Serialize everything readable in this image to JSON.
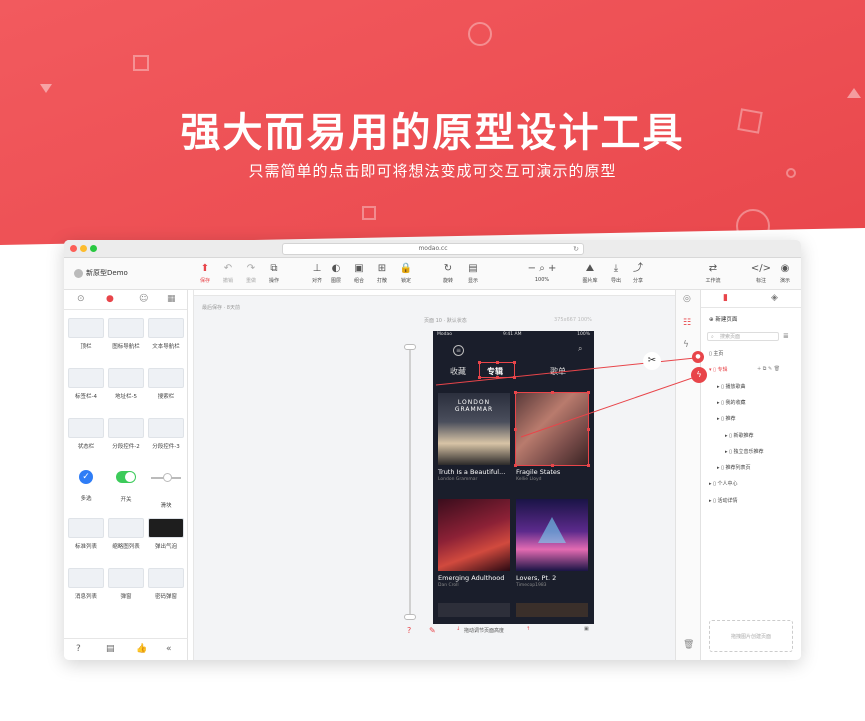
{
  "hero": {
    "title": "强大而易用的原型设计工具",
    "subtitle": "只需简单的点击即可将想法变成可交互可演示的原型"
  },
  "colors": {
    "brand": "#e8454a",
    "canvas": "#f3f4f6",
    "phone_bg": "#1a1e2b"
  },
  "browser": {
    "url": "modao.cc"
  },
  "project": {
    "name": "新原型Demo"
  },
  "toolbar": {
    "left": [
      {
        "icon": "save-icon",
        "label": "保存",
        "state": "active"
      },
      {
        "icon": "undo-icon",
        "label": "撤销",
        "state": "disabled"
      },
      {
        "icon": "redo-icon",
        "label": "重做",
        "state": "disabled"
      },
      {
        "icon": "action-icon",
        "label": "操作",
        "state": "normal"
      }
    ],
    "middle": [
      {
        "icon": "align-icon",
        "label": "对齐"
      },
      {
        "icon": "layer-order-icon",
        "label": "图层"
      },
      {
        "icon": "group-icon",
        "label": "组合"
      },
      {
        "icon": "ungroup-icon",
        "label": "打散"
      },
      {
        "icon": "lock-icon",
        "label": "锁定"
      }
    ],
    "view": [
      {
        "icon": "rotate-icon",
        "label": "旋转"
      },
      {
        "icon": "display-icon",
        "label": "显示"
      }
    ],
    "zoom": "100%",
    "right": [
      {
        "icon": "image-library-icon",
        "label": "图片库"
      },
      {
        "icon": "export-icon",
        "label": "导出"
      },
      {
        "icon": "share-icon",
        "label": "分享"
      }
    ],
    "far_right": [
      {
        "icon": "workflow-icon",
        "label": "工作流"
      },
      {
        "icon": "annotate-icon",
        "label": "标注"
      },
      {
        "icon": "preview-icon",
        "label": "演示"
      }
    ]
  },
  "components": [
    {
      "label": "顶栏"
    },
    {
      "label": "图标导航栏"
    },
    {
      "label": "文本导航栏"
    },
    {
      "label": "标签栏-4"
    },
    {
      "label": "地址栏-5"
    },
    {
      "label": "搜索栏"
    },
    {
      "label": "状态栏"
    },
    {
      "label": "分段控件-2"
    },
    {
      "label": "分段控件-3"
    },
    {
      "label": "多选"
    },
    {
      "label": "开关"
    },
    {
      "label": "滑块"
    },
    {
      "label": "标准列表"
    },
    {
      "label": "缩略图列表"
    },
    {
      "label": "弹出气泡"
    },
    {
      "label": "消息列表"
    },
    {
      "label": "弹窗"
    },
    {
      "label": "密码弹窗"
    }
  ],
  "canvas": {
    "breadcrumb": "最后保存 · 8天前",
    "page_label": "页面 10 · 默认状态",
    "page_size": "375x667 100%",
    "footer_hint": "拖动调节页面高度"
  },
  "phone": {
    "carrier": "Modao",
    "time": "9:41 AM",
    "battery": "100%",
    "tabs": [
      "收藏",
      "专辑",
      "歌单"
    ],
    "selected_tab": "专辑",
    "albums": [
      {
        "title": "Truth Is a Beautiful...",
        "artist": "London Grammar",
        "cover_text": "LONDON GRAMMAR"
      },
      {
        "title": "Fragile States",
        "artist": "Kellie Lloyd",
        "cover_text": ""
      },
      {
        "title": "Emerging Adulthood",
        "artist": "Dan Croll",
        "cover_text": ""
      },
      {
        "title": "Lovers, Pt. 2",
        "artist": "Timecop1983",
        "cover_text": ""
      }
    ]
  },
  "right_panel": {
    "new_page": "新建页面",
    "search_placeholder": "搜索页面",
    "tree": [
      {
        "label": "主页",
        "level": 0,
        "selected": false
      },
      {
        "label": "专辑",
        "level": 0,
        "selected": true
      },
      {
        "label": "播放歌曲",
        "level": 1,
        "selected": false
      },
      {
        "label": "我的收藏",
        "level": 1,
        "selected": false
      },
      {
        "label": "推荐",
        "level": 1,
        "selected": false
      },
      {
        "label": "新歌推荐",
        "level": 2,
        "selected": false
      },
      {
        "label": "独立音乐推荐",
        "level": 2,
        "selected": false
      },
      {
        "label": "推荐列表页",
        "level": 1,
        "selected": false
      },
      {
        "label": "个人中心",
        "level": 0,
        "selected": false
      },
      {
        "label": "活动详情",
        "level": 0,
        "selected": false
      }
    ],
    "upload_hint": "拖拽图片创建页面"
  }
}
